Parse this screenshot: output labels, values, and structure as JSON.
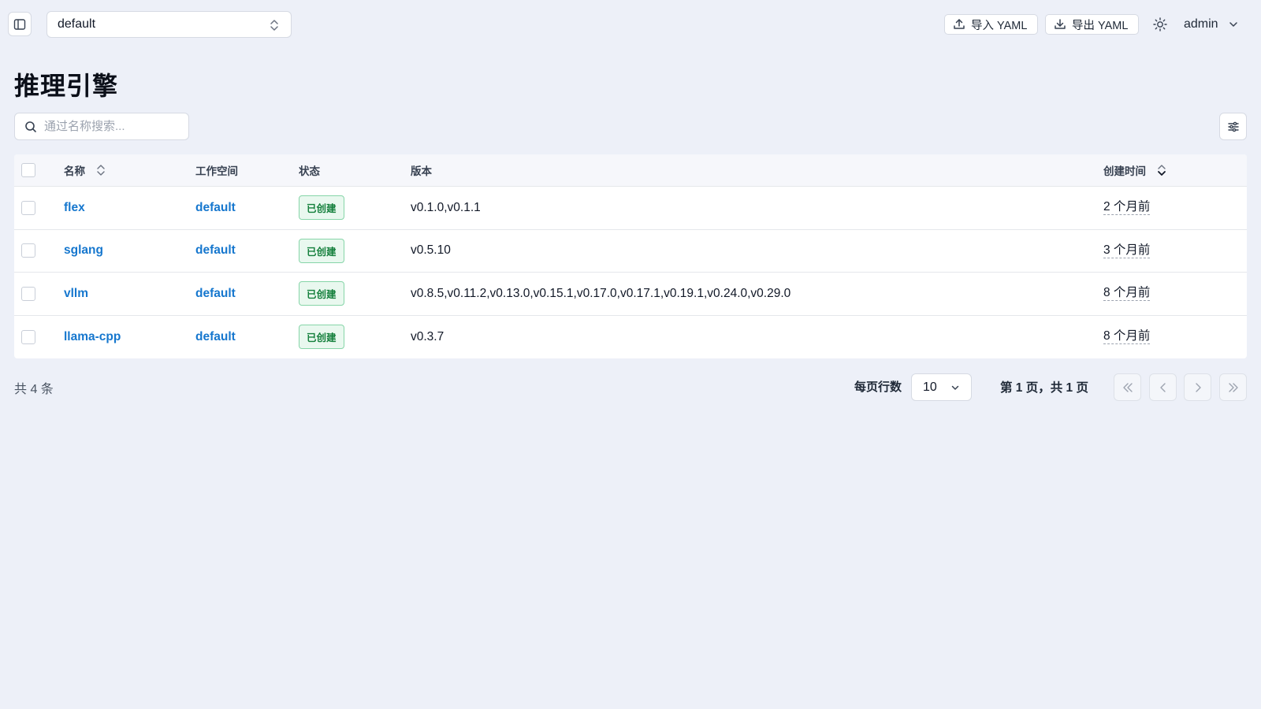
{
  "topbar": {
    "workspace_selected": "default",
    "import_label": "导入 YAML",
    "export_label": "导出 YAML",
    "user_name": "admin"
  },
  "page": {
    "title": "推理引擎",
    "search_placeholder": "通过名称搜索..."
  },
  "table": {
    "headers": {
      "name": "名称",
      "workspace": "工作空间",
      "status": "状态",
      "version": "版本",
      "created": "创建时间"
    },
    "rows": [
      {
        "name": "flex",
        "workspace": "default",
        "status": "已创建",
        "version": "v0.1.0,v0.1.1",
        "created": "2 个月前"
      },
      {
        "name": "sglang",
        "workspace": "default",
        "status": "已创建",
        "version": "v0.5.10",
        "created": "3 个月前"
      },
      {
        "name": "vllm",
        "workspace": "default",
        "status": "已创建",
        "version": "v0.8.5,v0.11.2,v0.13.0,v0.15.1,v0.17.0,v0.17.1,v0.19.1,v0.24.0,v0.29.0",
        "created": "8 个月前"
      },
      {
        "name": "llama-cpp",
        "workspace": "default",
        "status": "已创建",
        "version": "v0.3.7",
        "created": "8 个月前"
      }
    ]
  },
  "pagination": {
    "total_text": "共 4 条",
    "rows_per_page_label": "每页行数",
    "page_size": "10",
    "page_info": "第 1 页，共 1 页"
  },
  "colors": {
    "background": "#edf0f8",
    "link": "#1677ce",
    "status_badge_bg": "#e9f8ef",
    "status_badge_text": "#15803d"
  }
}
